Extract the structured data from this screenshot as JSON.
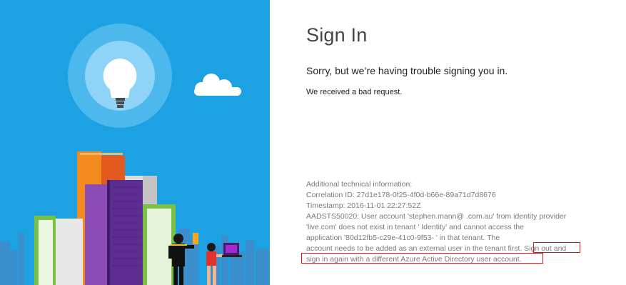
{
  "colors": {
    "panel_bg": "#1ca2e3",
    "highlight": "#d41616",
    "tech_text": "#7a7a7a"
  },
  "icons": {
    "hero": "lightbulb-icon",
    "cloud": "cloud-icon"
  },
  "signin": {
    "title": "Sign In",
    "subtitle": "Sorry, but we’re having trouble signing you in.",
    "message": "We received a bad request."
  },
  "tech": {
    "lines": [
      "Additional technical information:",
      "Correlation ID: 27d1e178-0f25-4f0d-b66e-89a71d7d8676",
      "Timestamp: 2016-11-01 22:27:52Z",
      "AADSTS50020: User account 'stephen.mann@        .com.au' from identity provider",
      "'live.com' does not exist in tenant '        Identity' and cannot access the",
      "application '80d12fb5-c29e-41c0-9f53-                    ' in that tenant. The",
      "account needs to be added as an external user in the tenant first. Sign out and",
      "sign in again with a different Azure Active Directory user account."
    ]
  }
}
